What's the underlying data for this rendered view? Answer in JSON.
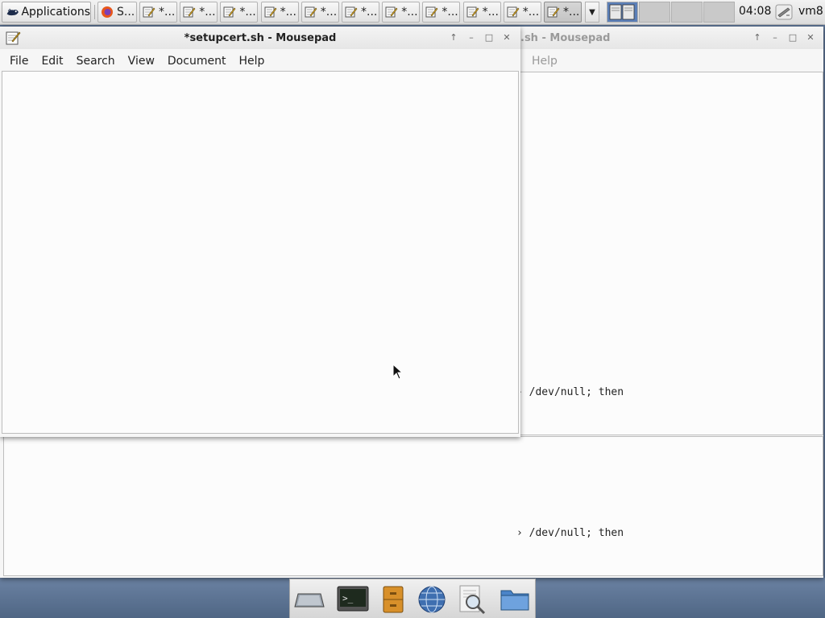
{
  "panel": {
    "applications_label": "Applications",
    "tasks": [
      {
        "label": "S...",
        "icon": "firefox-icon"
      },
      {
        "label": "*...",
        "icon": "text-editor-icon"
      },
      {
        "label": "*...",
        "icon": "text-editor-icon"
      },
      {
        "label": "*...",
        "icon": "text-editor-icon"
      },
      {
        "label": "*...",
        "icon": "text-editor-icon"
      },
      {
        "label": "*...",
        "icon": "text-editor-icon"
      },
      {
        "label": "*...",
        "icon": "text-editor-icon"
      },
      {
        "label": "*...",
        "icon": "text-editor-icon"
      },
      {
        "label": "*...",
        "icon": "text-editor-icon"
      },
      {
        "label": "*...",
        "icon": "text-editor-icon"
      },
      {
        "label": "*...",
        "icon": "text-editor-icon"
      },
      {
        "label": "*...",
        "icon": "text-editor-icon"
      }
    ],
    "clock": "04:08",
    "user": "vm8"
  },
  "front_window": {
    "title": "*setupcert.sh - Mousepad",
    "menu": [
      "File",
      "Edit",
      "Search",
      "View",
      "Document",
      "Help"
    ]
  },
  "back_window": {
    "title_partial": ".sh - Mousepad",
    "menu_partial": "Help",
    "line_upper": "› /dev/null; then",
    "line_lower": "› /dev/null; then"
  },
  "dock": [
    {
      "name": "show-desktop-icon"
    },
    {
      "name": "terminal-icon"
    },
    {
      "name": "file-cabinet-icon"
    },
    {
      "name": "web-browser-icon"
    },
    {
      "name": "search-icon"
    },
    {
      "name": "folder-icon"
    }
  ],
  "colors": {
    "desktop": "#5b7191",
    "workspace_active": "#5b7fb8"
  }
}
